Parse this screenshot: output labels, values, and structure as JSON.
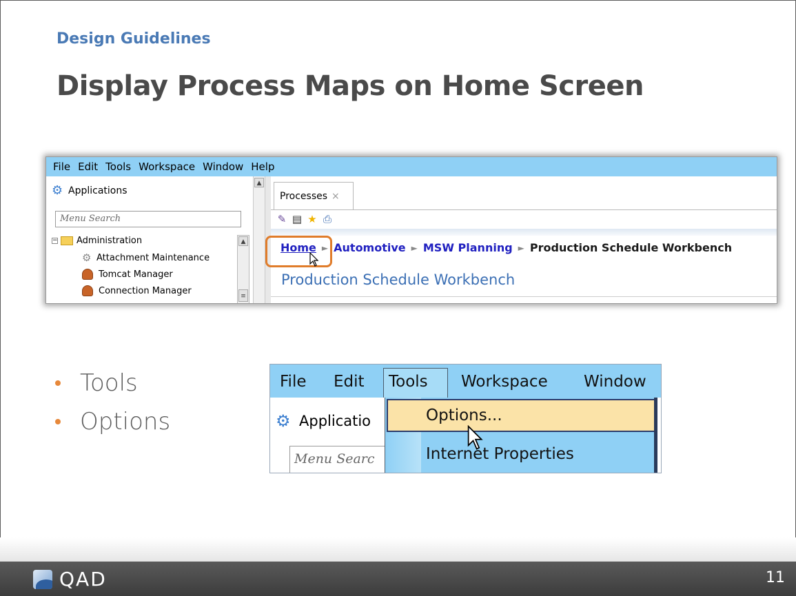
{
  "slide": {
    "subtitle": "Design Guidelines",
    "title": "Display Process Maps on Home Screen",
    "page_number": "11",
    "logo_text": "QAD"
  },
  "screenshot1": {
    "menubar": [
      "File",
      "Edit",
      "Tools",
      "Workspace",
      "Window",
      "Help"
    ],
    "applications_label": "Applications",
    "search_placeholder": "Menu Search",
    "tree": [
      {
        "label": "Administration",
        "icon": "folder-icon"
      },
      {
        "label": "Attachment Maintenance",
        "icon": "cog-icon"
      },
      {
        "label": "Tomcat Manager",
        "icon": "user-icon"
      },
      {
        "label": "Connection Manager",
        "icon": "user-icon"
      }
    ],
    "tab_label": "Processes",
    "tab_close": "×",
    "breadcrumb": [
      "Home",
      "Automotive",
      "MSW Planning",
      "Production Schedule Workbench"
    ],
    "breadcrumb_sep": "►",
    "page_title": "Production Schedule Workbench",
    "highlight_color": "#e07c2a"
  },
  "bullets": [
    "Tools",
    "Options"
  ],
  "screenshot2": {
    "menubar": [
      "File",
      "Edit",
      "Tools",
      "Workspace",
      "Window"
    ],
    "applications_label": "Applicatio",
    "search_placeholder": "Menu Searc",
    "dropdown": [
      "Options...",
      "Internet Properties"
    ]
  },
  "colors": {
    "menubar": "#8fd0f5",
    "title": "#4a4a4a",
    "subtitle": "#4a7ab5",
    "bullet": "#e7883a",
    "link": "#2020c0",
    "footer": "#4a4a4a"
  }
}
